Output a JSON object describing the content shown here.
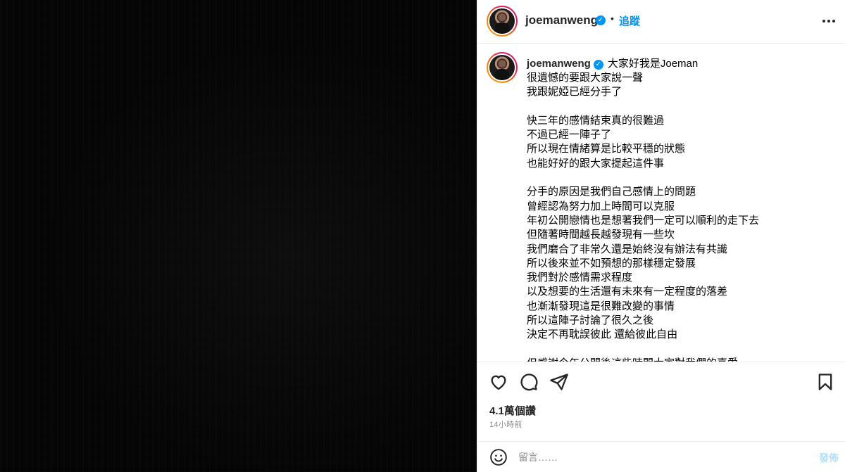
{
  "post": {
    "username": "joemanweng",
    "verified_badge": "✓",
    "separator": "•",
    "follow_label": "追蹤",
    "more_icon": "more-horizontal-icon"
  },
  "caption": {
    "username": "joemanweng",
    "first_line": "大家好我是Joeman",
    "body": "很遺憾的要跟大家說一聲\n我跟妮婭已經分手了\n\n快三年的感情結束真的很難過\n不過已經一陣子了\n所以現在情緒算是比較平穩的狀態\n也能好好的跟大家提起這件事\n\n分手的原因是我們自己感情上的問題\n曾經認為努力加上時間可以克服\n年初公開戀情也是想著我們一定可以順利的走下去\n但隨著時間越長越發現有一些坎\n我們磨合了非常久還是始終沒有辦法有共識\n所以後來並不如預想的那樣穩定發展\n我們對於感情需求程度\n以及想要的生活還有未來有一定程度的落差\n也漸漸發現這是很難改變的事情\n所以這陣子討論了很久之後\n決定不再耽誤彼此 還給彼此自由\n\n但感謝今年公開後這些時間大家對我們的喜愛"
  },
  "actions": {
    "like_icon": "heart-icon",
    "comment_icon": "comment-icon",
    "share_icon": "send-icon",
    "save_icon": "bookmark-icon"
  },
  "stats": {
    "views": "4.1萬個讚",
    "time_ago": "14小時前"
  },
  "comment": {
    "placeholder": "留言……",
    "post_label": "發佈",
    "emoji_icon": "smiley-icon"
  },
  "colors": {
    "accent": "#0095f6",
    "post_disabled": "#b2dffc",
    "media_bg": "#050505"
  }
}
